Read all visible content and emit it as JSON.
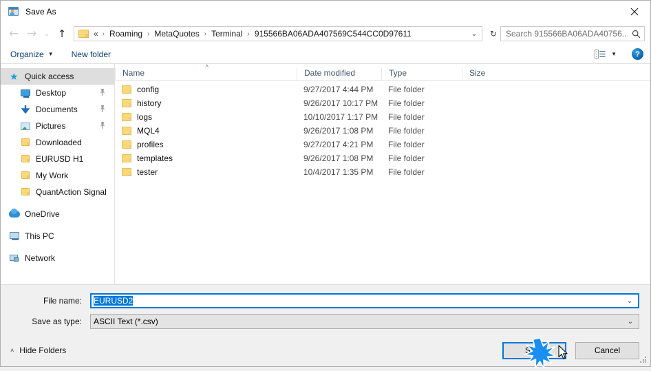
{
  "window": {
    "title": "Save As",
    "icon": "save-as-app-icon",
    "close_label": "✕"
  },
  "nav": {
    "back_icon": "←",
    "forward_icon": "→",
    "recent_icon": "⌄",
    "up_icon": "↑",
    "address": {
      "folder_icon": "folder-icon",
      "prefix": "«",
      "crumbs": [
        "Roaming",
        "MetaQuotes",
        "Terminal",
        "915566BA06ADA407569C544CC0D97611"
      ],
      "separator": "›",
      "caret": "⌄",
      "refresh": "↻"
    },
    "search": {
      "placeholder": "Search 915566BA06ADA40756...",
      "icon": "search-icon"
    }
  },
  "toolbar": {
    "organize_label": "Organize",
    "organize_caret": "▼",
    "new_folder_label": "New folder",
    "view_icon": "view-options-icon",
    "view_caret": "▼",
    "help_label": "?"
  },
  "sidebar": {
    "items": [
      {
        "label": "Quick access",
        "icon": "star-icon",
        "level": 1,
        "selected": true,
        "pinned": false
      },
      {
        "label": "Desktop",
        "icon": "desktop-icon",
        "level": 2,
        "selected": false,
        "pinned": true
      },
      {
        "label": "Documents",
        "icon": "documents-icon",
        "level": 2,
        "selected": false,
        "pinned": true
      },
      {
        "label": "Pictures",
        "icon": "pictures-icon",
        "level": 2,
        "selected": false,
        "pinned": true
      },
      {
        "label": "Downloaded",
        "icon": "folder-icon",
        "level": 2,
        "selected": false,
        "pinned": false
      },
      {
        "label": "EURUSD H1",
        "icon": "folder-icon",
        "level": 2,
        "selected": false,
        "pinned": false
      },
      {
        "label": "My Work",
        "icon": "folder-icon",
        "level": 2,
        "selected": false,
        "pinned": false
      },
      {
        "label": "QuantAction Signal",
        "icon": "folder-icon",
        "level": 2,
        "selected": false,
        "pinned": false
      },
      {
        "label": "OneDrive",
        "icon": "onedrive-icon",
        "level": 1,
        "selected": false,
        "pinned": false,
        "gap": true
      },
      {
        "label": "This PC",
        "icon": "this-pc-icon",
        "level": 1,
        "selected": false,
        "pinned": false,
        "gap": true
      },
      {
        "label": "Network",
        "icon": "network-icon",
        "level": 1,
        "selected": false,
        "pinned": false,
        "gap": true
      }
    ],
    "pin_icon": "ὌC"
  },
  "filelist": {
    "columns": [
      "Name",
      "Date modified",
      "Type",
      "Size"
    ],
    "sort_caret": "˄",
    "rows": [
      {
        "name": "config",
        "date": "9/27/2017 4:44 PM",
        "type": "File folder",
        "size": ""
      },
      {
        "name": "history",
        "date": "9/26/2017 10:17 PM",
        "type": "File folder",
        "size": ""
      },
      {
        "name": "logs",
        "date": "10/10/2017 1:17 PM",
        "type": "File folder",
        "size": ""
      },
      {
        "name": "MQL4",
        "date": "9/26/2017 1:08 PM",
        "type": "File folder",
        "size": ""
      },
      {
        "name": "profiles",
        "date": "9/27/2017 4:21 PM",
        "type": "File folder",
        "size": ""
      },
      {
        "name": "templates",
        "date": "9/26/2017 1:08 PM",
        "type": "File folder",
        "size": ""
      },
      {
        "name": "tester",
        "date": "10/4/2017 1:35 PM",
        "type": "File folder",
        "size": ""
      }
    ]
  },
  "form": {
    "filename_label": "File name:",
    "filename_value": "EURUSD2",
    "filetype_label": "Save as type:",
    "filetype_value": "ASCII Text (*.csv)",
    "caret": "⌄"
  },
  "footer": {
    "hide_folders_label": "Hide Folders",
    "hide_folders_caret": "˄",
    "save_label": "Save",
    "cancel_label": "Cancel"
  },
  "colors": {
    "accent": "#0078d7",
    "selection": "#0078d7",
    "sidebar_selected": "#dedede",
    "folder": "#fbd97a",
    "header_text": "#40566b",
    "link": "#0a3b73",
    "chrome": "#f0f0f0"
  }
}
